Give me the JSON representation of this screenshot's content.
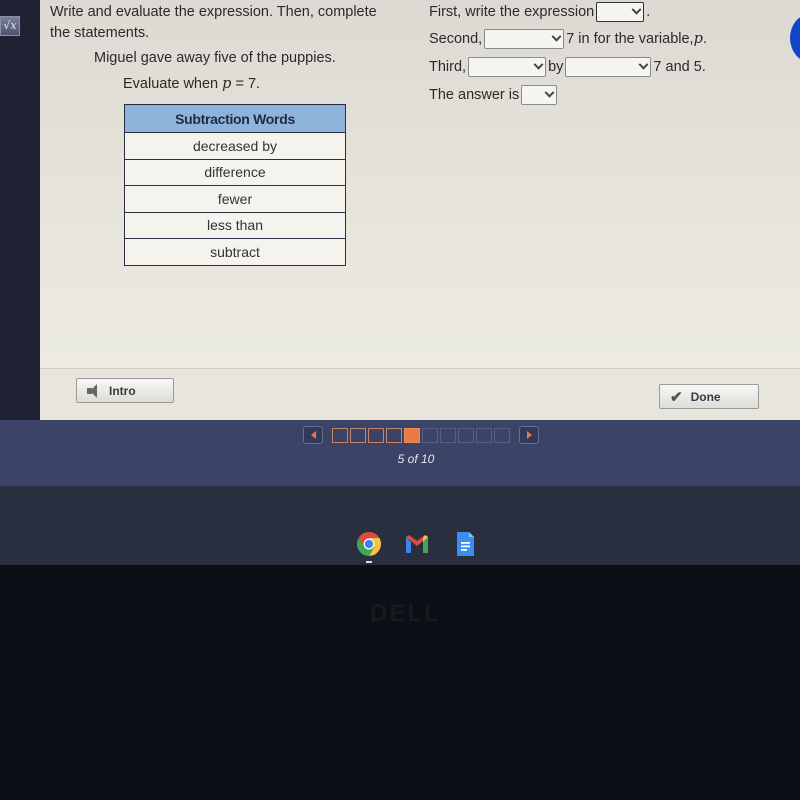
{
  "toolbar": {
    "tool_icon": "square-root-icon",
    "tool_glyph": "√x"
  },
  "question": {
    "instructions": "Write and evaluate the expression. Then, complete the statements.",
    "story": "Miguel gave away five of the puppies.",
    "evaluate_prefix": "Evaluate when ",
    "evaluate_var": "p",
    "evaluate_suffix": " = 7."
  },
  "table": {
    "header": "Subtraction Words",
    "rows": [
      "decreased by",
      "difference",
      "fewer",
      "less than",
      "subtract"
    ]
  },
  "statements": {
    "first": {
      "prefix": "First, write the expression",
      "suffix": ".",
      "dropdown_value": ""
    },
    "second": {
      "prefix": "Second,",
      "suffix": "7 in for the variable, ",
      "var": "p",
      "end": ".",
      "dropdown_value": ""
    },
    "third": {
      "prefix": "Third,",
      "middle": "by",
      "suffix": "7 and 5.",
      "dropdown1_value": "",
      "dropdown2_value": ""
    },
    "answer": {
      "prefix": "The answer is",
      "dropdown_value": ""
    }
  },
  "buttons": {
    "intro_label": "Intro",
    "done_label": "Done",
    "done_icon": "✔"
  },
  "pager": {
    "current": 5,
    "total": 10,
    "label": "5 of 10"
  },
  "shelf": {
    "apps": [
      "Chrome",
      "Gmail",
      "Google Docs"
    ]
  },
  "bezel": {
    "brand": "DELL"
  },
  "colors": {
    "accent_orange": "#ec7a45",
    "table_header": "#8fb4dc",
    "navy_bar": "#3b4366"
  }
}
